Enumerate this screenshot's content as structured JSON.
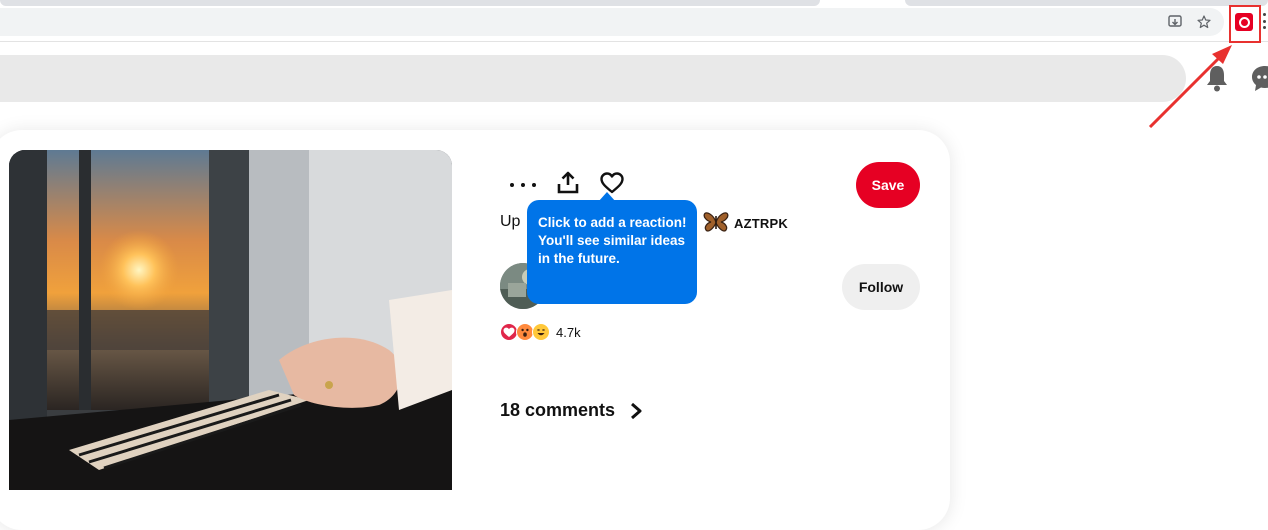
{
  "browser": {
    "icons": [
      "install-app-icon",
      "bookmark-star-icon",
      "pinterest-extension-icon",
      "more-menu-icon"
    ]
  },
  "header": {
    "icons": [
      "notifications-bell-icon",
      "messages-icon"
    ]
  },
  "pin": {
    "title_fragment": "Up",
    "brand_name": "AZTRPK",
    "save_label": "Save",
    "follow_label": "Follow",
    "reaction_count": "4.7k",
    "comments_label": "18 comments",
    "tooltip_text": "Click to add a reaction! You'll see similar ideas in the future."
  },
  "colors": {
    "pinterest_red": "#e60023",
    "tooltip_blue": "#0074e8",
    "annotation_red": "#e8312f"
  }
}
